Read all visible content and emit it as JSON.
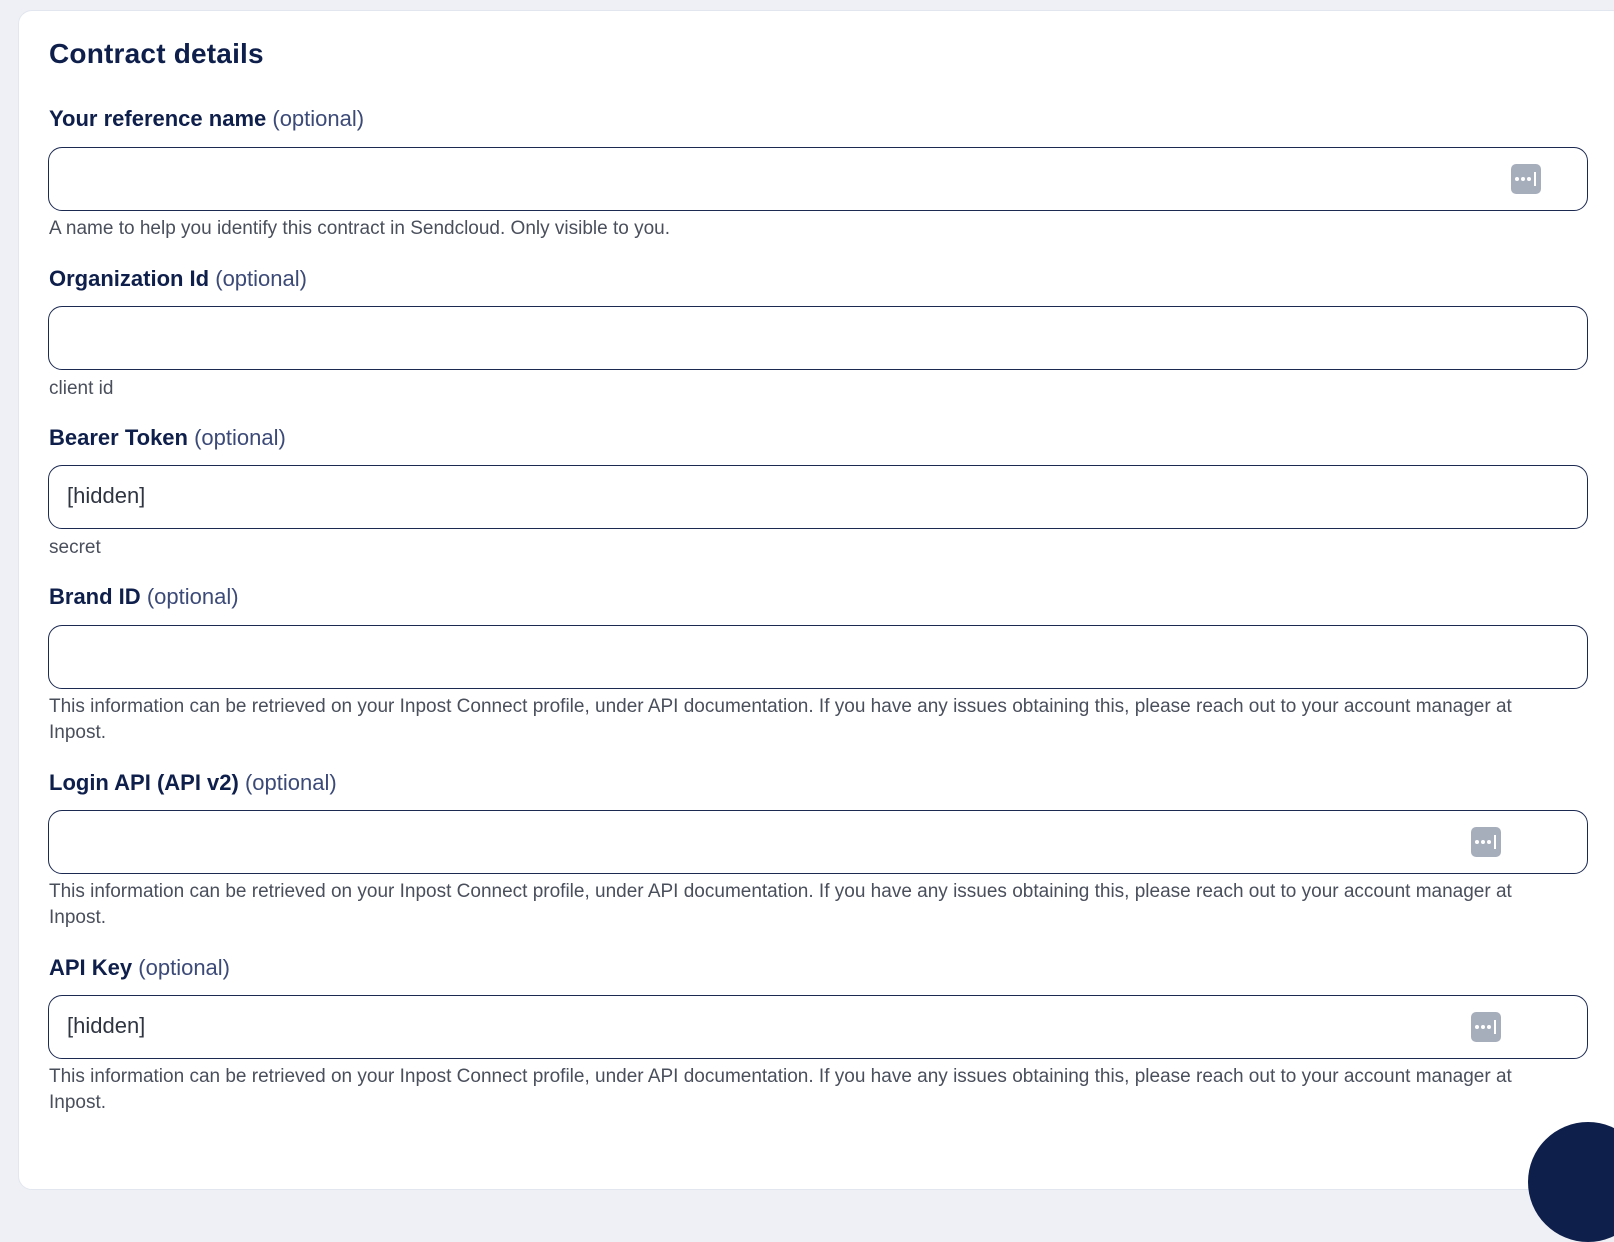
{
  "section": {
    "title": "Contract details"
  },
  "fields": {
    "reference_name": {
      "label": "Your reference name",
      "optional": "(optional)",
      "value": "",
      "help": "A name to help you identify this contract in Sendcloud. Only visible to you.",
      "icon": "password-manager-icon"
    },
    "organization_id": {
      "label": "Organization Id",
      "optional": "(optional)",
      "value": "",
      "help": "client id"
    },
    "bearer_token": {
      "label": "Bearer Token",
      "optional": "(optional)",
      "value": "[hidden]",
      "help": "secret"
    },
    "brand_id": {
      "label": "Brand ID",
      "optional": "(optional)",
      "value": "",
      "help": "This information can be retrieved on your Inpost Connect profile, under API documentation. If you have any issues obtaining this, please reach out to your account manager at Inpost."
    },
    "login_api": {
      "label": "Login API (API v2)",
      "optional": "(optional)",
      "value": "",
      "help": "This information can be retrieved on your Inpost Connect profile, under API documentation. If you have any issues obtaining this, please reach out to your account manager at Inpost.",
      "icon": "password-manager-icon"
    },
    "api_key": {
      "label": "API Key",
      "optional": "(optional)",
      "value": "[hidden]",
      "help": "This information can be retrieved on your Inpost Connect profile, under API documentation. If you have any issues obtaining this, please reach out to your account manager at Inpost.",
      "icon": "password-manager-icon"
    }
  },
  "colors": {
    "heading": "#0f1f4b",
    "optional_text": "#3c4a78",
    "input_border": "#1c2a52",
    "help_text": "#4a4f5c",
    "page_background": "#eef0f5",
    "icon_gray": "#a7aebb"
  }
}
